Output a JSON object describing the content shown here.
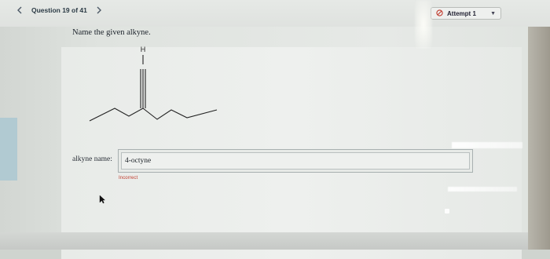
{
  "header": {
    "prev_icon": "chevron-left-icon",
    "question_label": "Question 19 of 41",
    "next_icon": "chevron-right-icon",
    "attempt_icon": "no-entry-icon",
    "attempt_label": "Attempt 1",
    "attempt_dropdown_icon": "caret-down-icon"
  },
  "question": {
    "prompt": "Name the given alkyne.",
    "structure_atom_label": "H"
  },
  "answer": {
    "label": "alkyne name:",
    "value": "4-octyne",
    "feedback": "Incorrect"
  },
  "colors": {
    "feedback": "#c0392b",
    "attempt_icon": "#c0392b",
    "left_accent": "#a6c5d1"
  }
}
